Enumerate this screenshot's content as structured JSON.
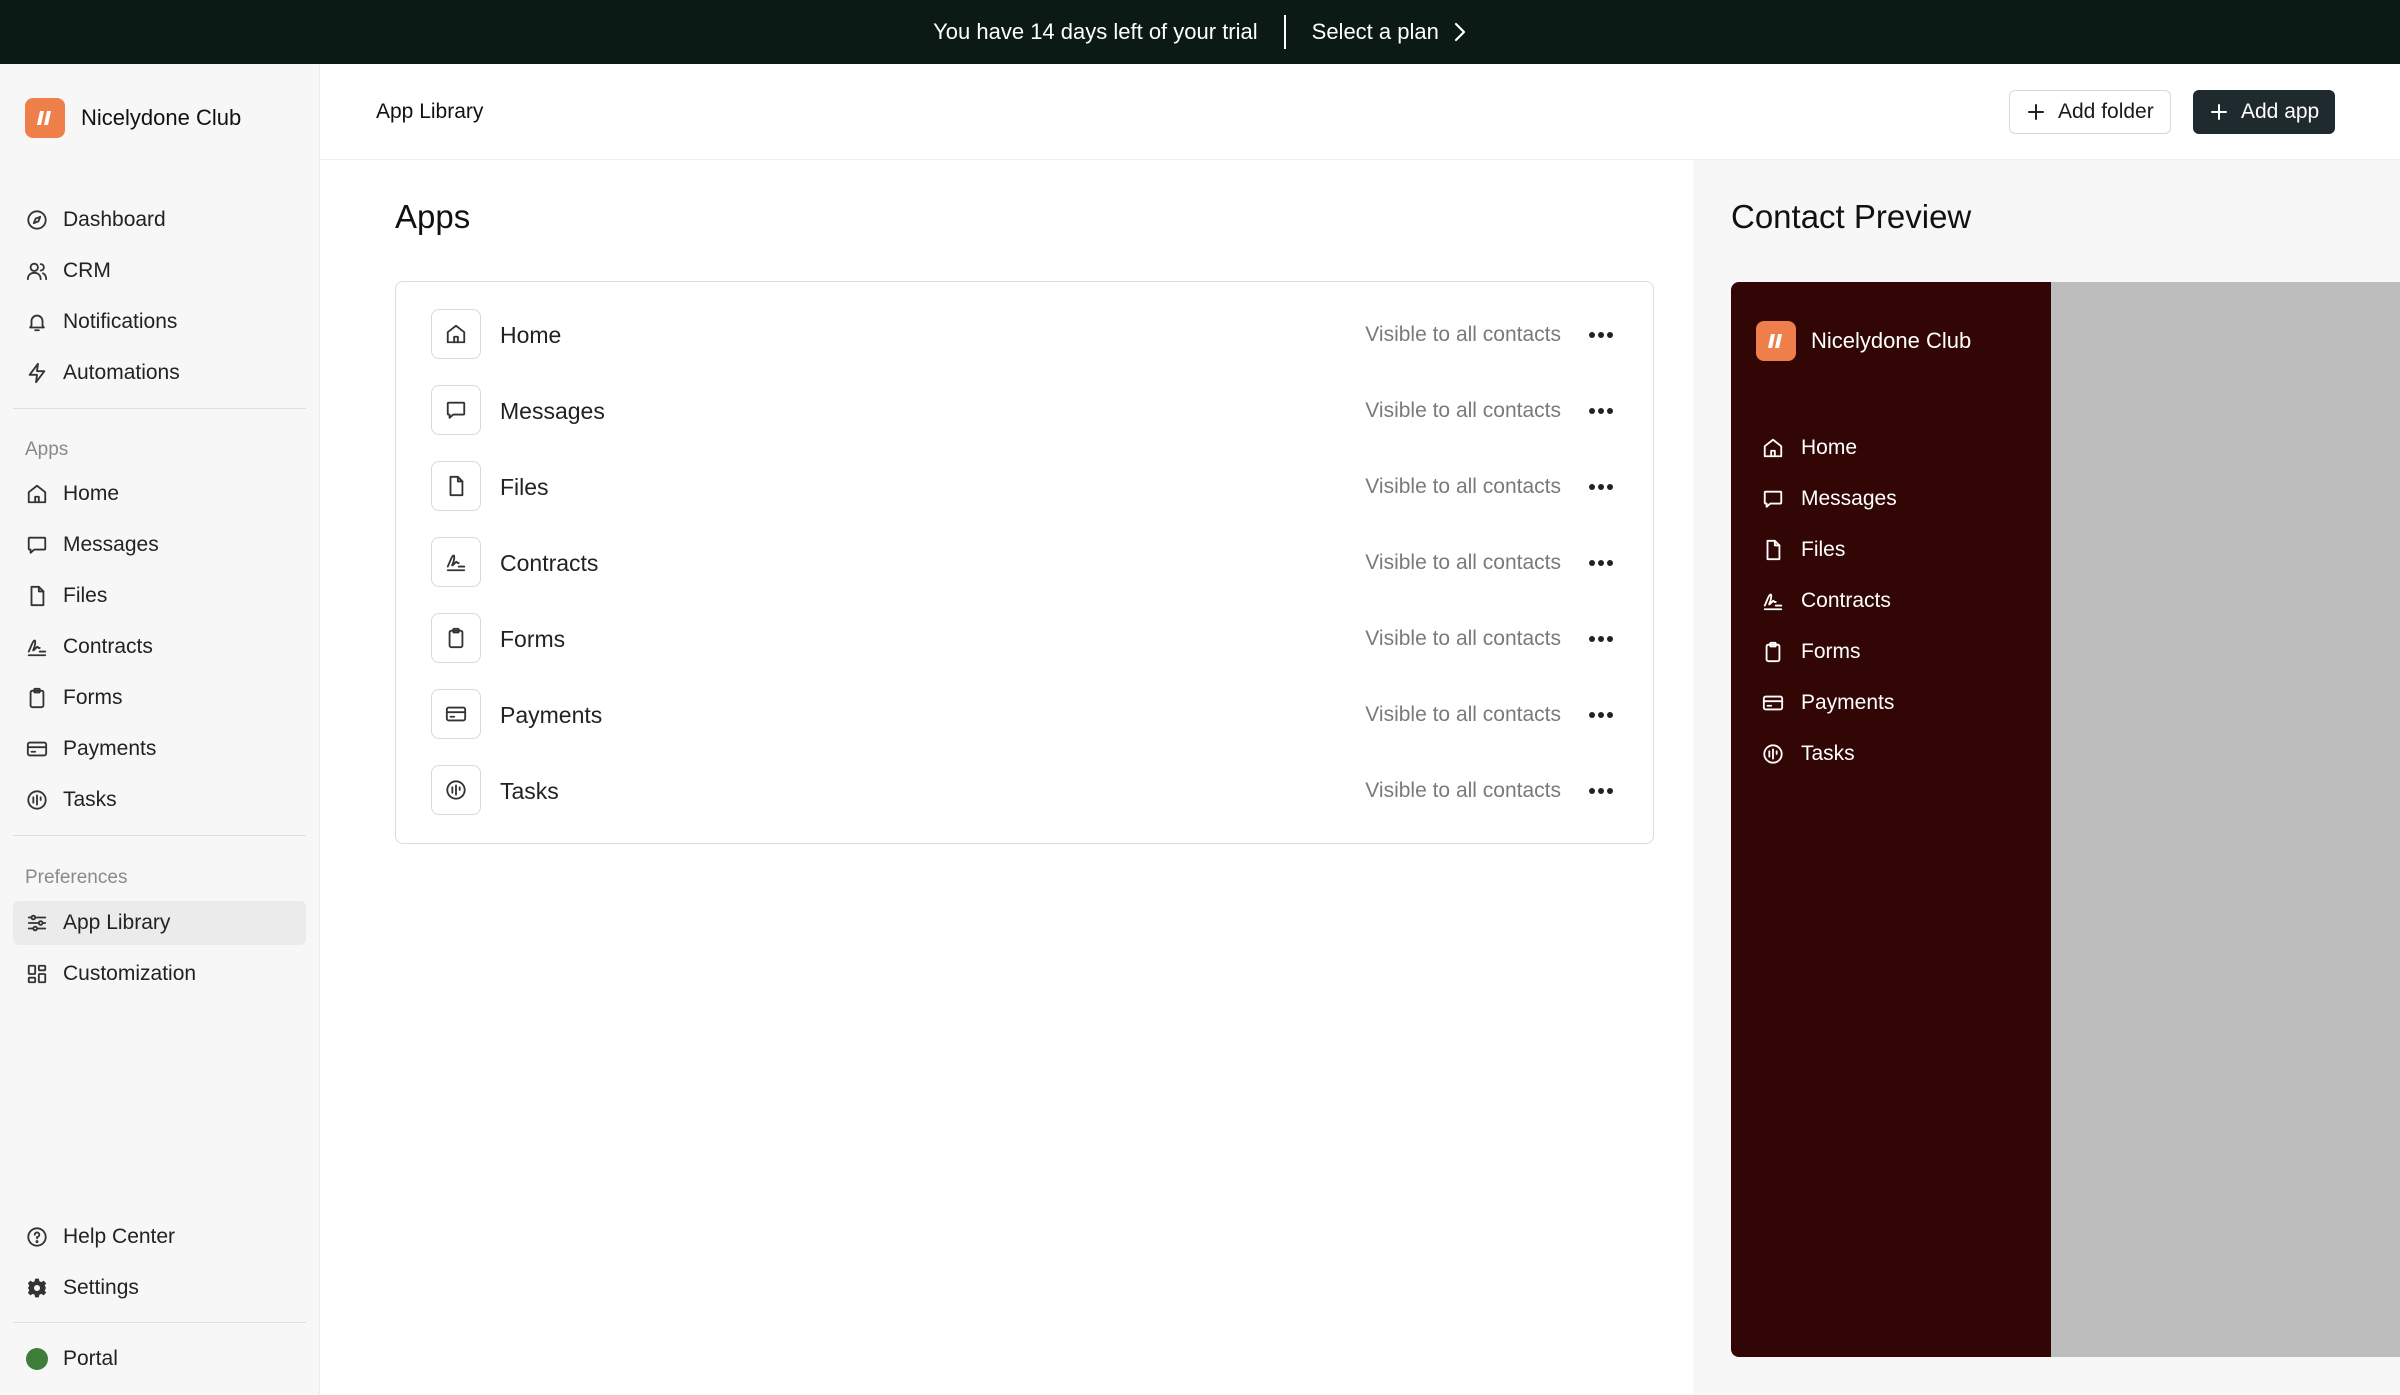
{
  "banner": {
    "trial_text": "You have 14 days left of your trial",
    "plan_link": "Select a plan"
  },
  "workspace": {
    "name": "Nicelydone Club"
  },
  "sidebar": {
    "main": [
      {
        "label": "Dashboard",
        "icon": "compass-icon"
      },
      {
        "label": "CRM",
        "icon": "users-icon"
      },
      {
        "label": "Notifications",
        "icon": "bell-icon"
      },
      {
        "label": "Automations",
        "icon": "bolt-icon"
      }
    ],
    "apps_label": "Apps",
    "apps": [
      {
        "label": "Home",
        "icon": "home-icon"
      },
      {
        "label": "Messages",
        "icon": "message-icon"
      },
      {
        "label": "Files",
        "icon": "file-icon"
      },
      {
        "label": "Contracts",
        "icon": "signature-icon"
      },
      {
        "label": "Forms",
        "icon": "clipboard-icon"
      },
      {
        "label": "Payments",
        "icon": "credit-card-icon"
      },
      {
        "label": "Tasks",
        "icon": "tasks-icon"
      }
    ],
    "preferences_label": "Preferences",
    "preferences": [
      {
        "label": "App Library",
        "icon": "sliders-icon",
        "active": true
      },
      {
        "label": "Customization",
        "icon": "grid-icon"
      }
    ],
    "bottom": [
      {
        "label": "Help Center",
        "icon": "help-icon"
      },
      {
        "label": "Settings",
        "icon": "gear-icon"
      }
    ],
    "portal": {
      "label": "Portal",
      "status_color": "#3f7d3b"
    }
  },
  "header": {
    "title": "App Library",
    "add_folder": "Add folder",
    "add_app": "Add app"
  },
  "main": {
    "title": "Apps",
    "apps": [
      {
        "name": "Home",
        "visibility": "Visible to all contacts",
        "icon": "home-icon"
      },
      {
        "name": "Messages",
        "visibility": "Visible to all contacts",
        "icon": "message-icon"
      },
      {
        "name": "Files",
        "visibility": "Visible to all contacts",
        "icon": "file-icon"
      },
      {
        "name": "Contracts",
        "visibility": "Visible to all contacts",
        "icon": "signature-icon"
      },
      {
        "name": "Forms",
        "visibility": "Visible to all contacts",
        "icon": "clipboard-icon"
      },
      {
        "name": "Payments",
        "visibility": "Visible to all contacts",
        "icon": "credit-card-icon"
      },
      {
        "name": "Tasks",
        "visibility": "Visible to all contacts",
        "icon": "tasks-icon"
      }
    ]
  },
  "preview": {
    "title": "Contact Preview",
    "brand": "Nicelydone Club",
    "items": [
      {
        "label": "Home",
        "icon": "home-icon"
      },
      {
        "label": "Messages",
        "icon": "message-icon"
      },
      {
        "label": "Files",
        "icon": "file-icon"
      },
      {
        "label": "Contracts",
        "icon": "signature-icon"
      },
      {
        "label": "Forms",
        "icon": "clipboard-icon"
      },
      {
        "label": "Payments",
        "icon": "credit-card-icon"
      },
      {
        "label": "Tasks",
        "icon": "tasks-icon"
      }
    ],
    "sidebar_color": "#330606"
  },
  "colors": {
    "brand": "#ee7f4b",
    "banner": "#0c1a16",
    "primary_button": "#1f2a2e"
  }
}
